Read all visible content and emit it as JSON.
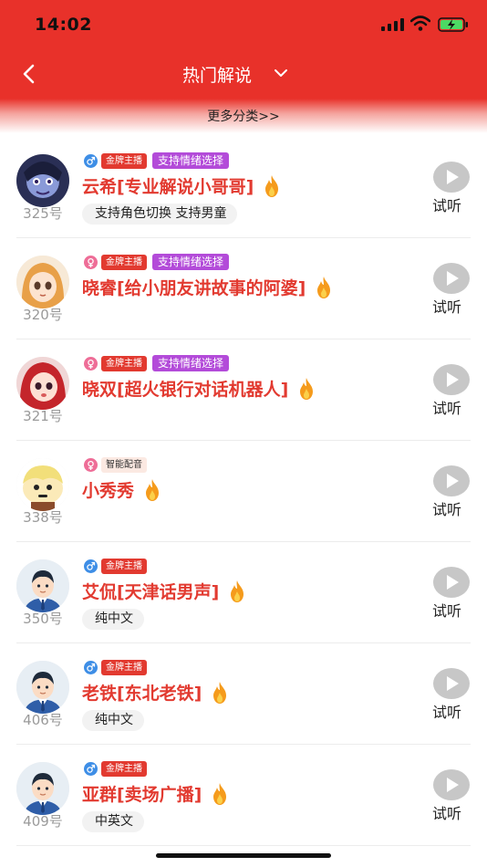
{
  "status_bar": {
    "time": "14:02"
  },
  "nav": {
    "title": "热门解说",
    "more_label": "更多分类>>"
  },
  "colors": {
    "brand_red": "#e8312a",
    "name_red": "#e23a30",
    "emotion_purple": "#b34bd9",
    "male_blue": "#3e8ee6",
    "female_pink": "#ee6d97"
  },
  "labels": {
    "listen": "试听"
  },
  "voices": [
    {
      "number": "325号",
      "gender": "male",
      "badge": "金牌主播",
      "emotion": "支持情绪选择",
      "name": "云希[专业解说小哥哥]",
      "features": "支持角色切换 支持男童",
      "avatar_icon": "dark-monster-avatar"
    },
    {
      "number": "320号",
      "gender": "female",
      "badge": "金牌主播",
      "emotion": "支持情绪选择",
      "name": "晓睿[给小朋友讲故事的阿婆]",
      "features": "",
      "avatar_icon": "anime-girl-avatar"
    },
    {
      "number": "321号",
      "gender": "female",
      "badge": "金牌主播",
      "emotion": "支持情绪选择",
      "name": "晓双[超火银行对话机器人]",
      "features": "",
      "avatar_icon": "anime-redhead-avatar"
    },
    {
      "number": "338号",
      "gender": "female",
      "badge": "智能配音",
      "emotion": "",
      "name": "小秀秀",
      "features": "",
      "avatar_icon": "cartoon-kid-avatar"
    },
    {
      "number": "350号",
      "gender": "male",
      "badge": "金牌主播",
      "emotion": "",
      "name": "艾侃[天津话男声]",
      "features": "纯中文",
      "avatar_icon": "business-man-avatar"
    },
    {
      "number": "406号",
      "gender": "male",
      "badge": "金牌主播",
      "emotion": "",
      "name": "老铁[东北老铁]",
      "features": "纯中文",
      "avatar_icon": "business-man-avatar"
    },
    {
      "number": "409号",
      "gender": "male",
      "badge": "金牌主播",
      "emotion": "",
      "name": "亚群[卖场广播]",
      "features": "中英文",
      "avatar_icon": "business-man-avatar"
    }
  ]
}
